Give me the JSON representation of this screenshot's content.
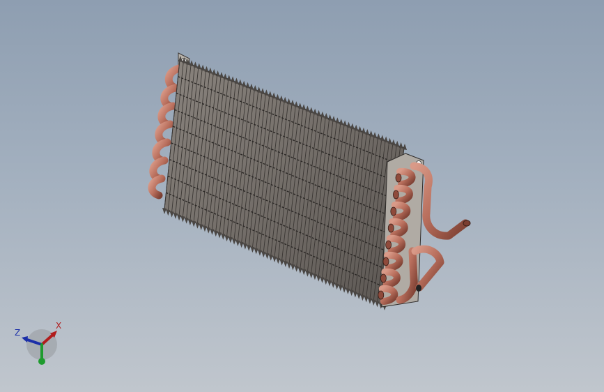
{
  "viewport": {
    "background_top": "#8e9eb1",
    "background_bottom": "#c0c6cd"
  },
  "model": {
    "part": "heat-exchanger-condenser",
    "fin_color": "#6e6a66",
    "plate_color": "#b0aba4",
    "tube_color": "#b86e5c"
  },
  "triad": {
    "x_label": "X",
    "z_label": "Z",
    "x_color": "#b11c1c",
    "y_color": "#1e9b2e",
    "z_color": "#1b2fa8"
  }
}
